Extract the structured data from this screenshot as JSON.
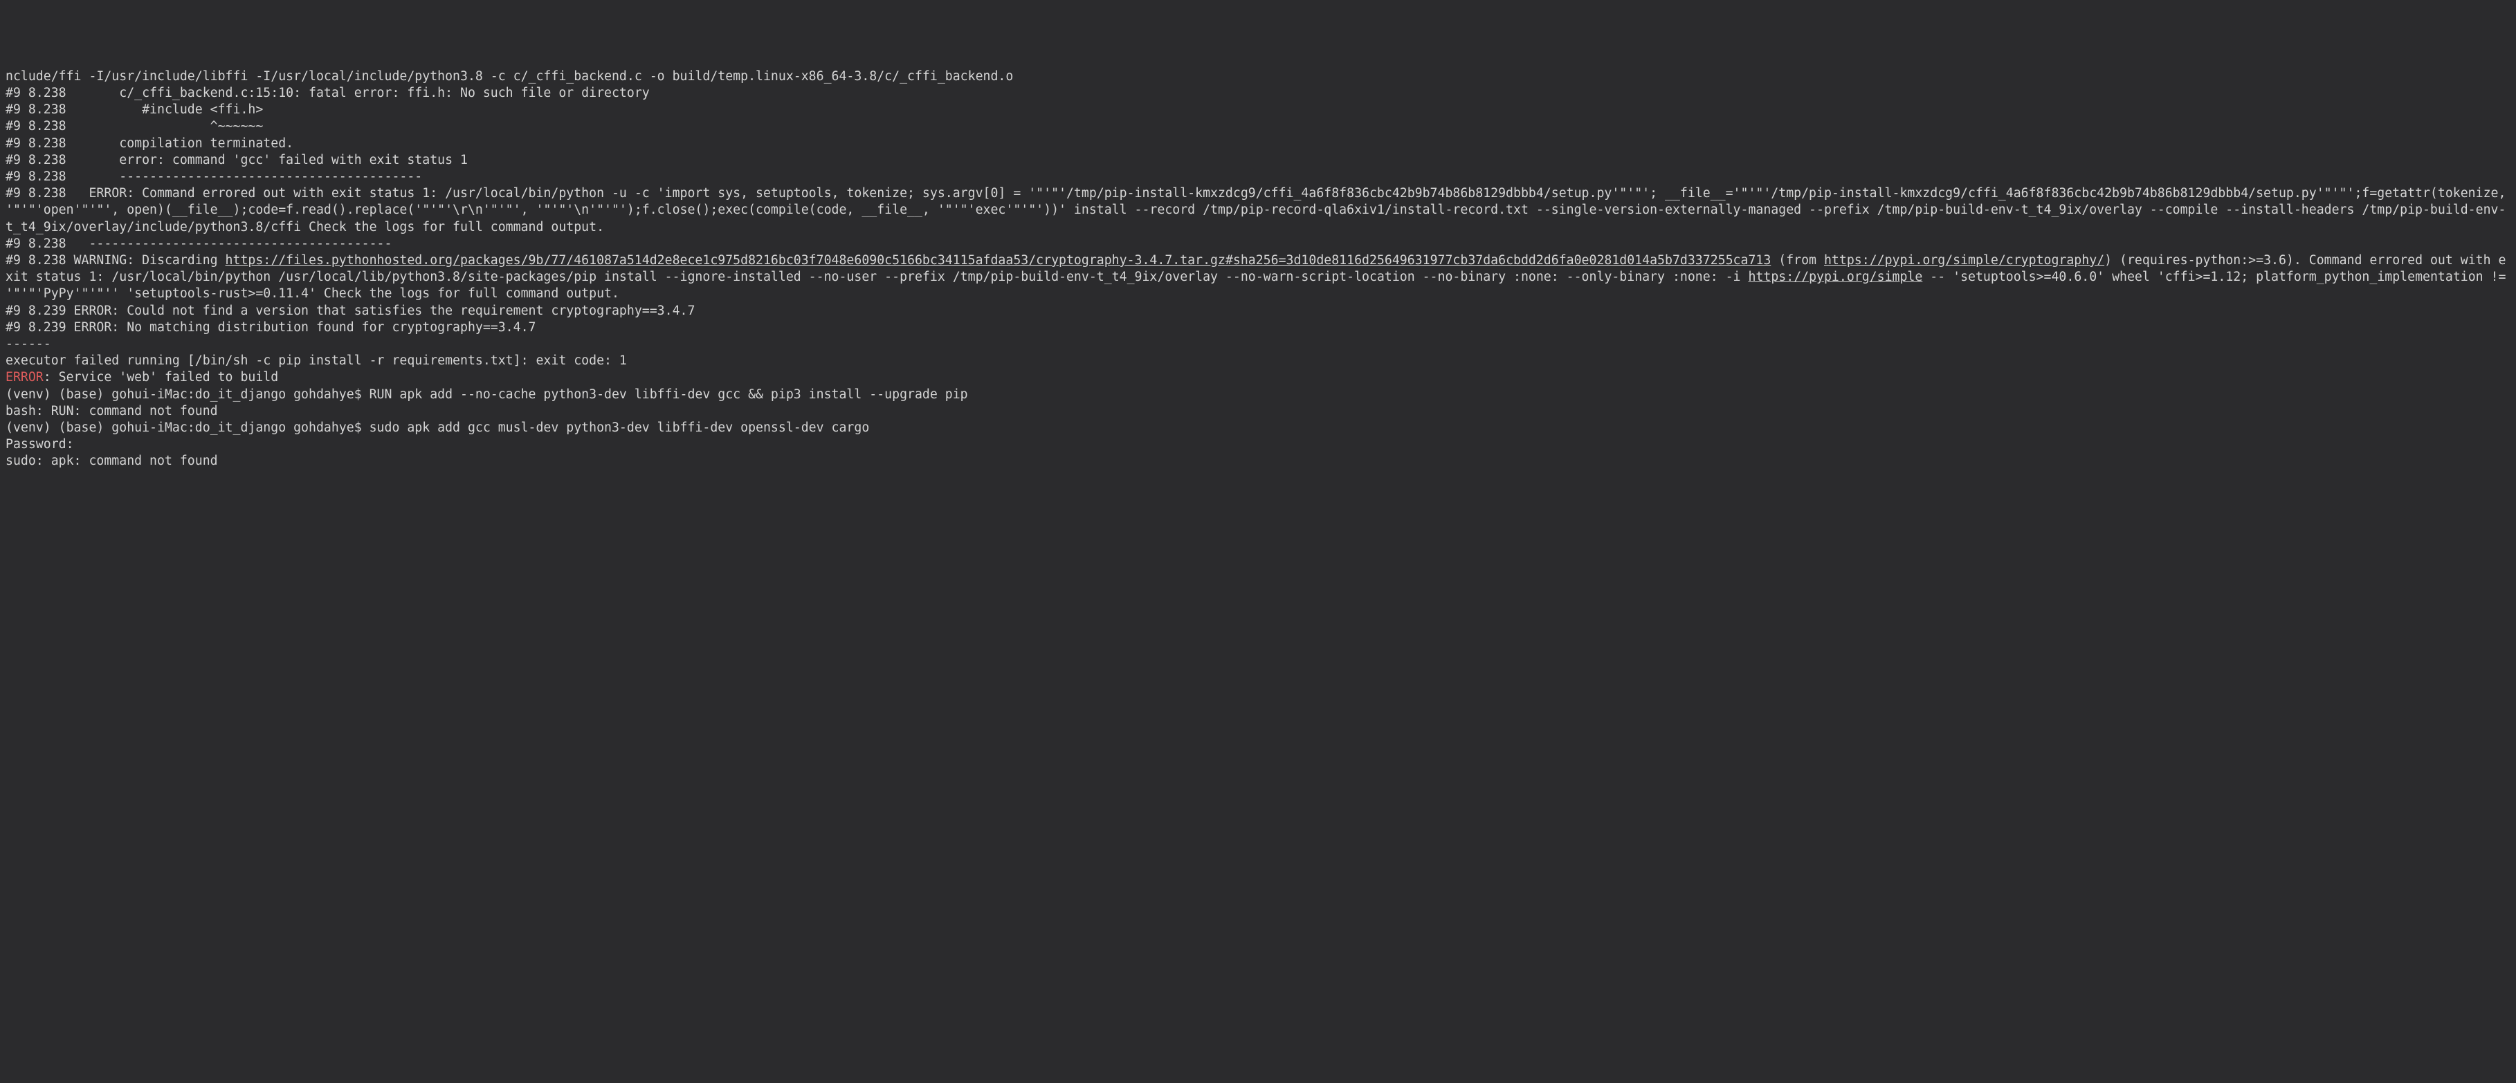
{
  "lines": {
    "l01": "nclude/ffi -I/usr/include/libffi -I/usr/local/include/python3.8 -c c/_cffi_backend.c -o build/temp.linux-x86_64-3.8/c/_cffi_backend.o",
    "l02": "#9 8.238       c/_cffi_backend.c:15:10: fatal error: ffi.h: No such file or directory",
    "l03": "#9 8.238          #include <ffi.h>",
    "l04": "#9 8.238                   ^~~~~~~",
    "l05": "#9 8.238       compilation terminated.",
    "l06": "#9 8.238       error: command 'gcc' failed with exit status 1",
    "l07": "#9 8.238       ----------------------------------------",
    "l08": "#9 8.238   ERROR: Command errored out with exit status 1: /usr/local/bin/python -u -c 'import sys, setuptools, tokenize; sys.argv[0] = '\"'\"'/tmp/pip-install-kmxzdcg9/cffi_4a6f8f836cbc42b9b74b86b8129dbbb4/setup.py'\"'\"'; __file__='\"'\"'/tmp/pip-install-kmxzdcg9/cffi_4a6f8f836cbc42b9b74b86b8129dbbb4/setup.py'\"'\"';f=getattr(tokenize, '\"'\"'open'\"'\"', open)(__file__);code=f.read().replace('\"'\"'\\r\\n'\"'\"', '\"'\"'\\n'\"'\"');f.close();exec(compile(code, __file__, '\"'\"'exec'\"'\"'))' install --record /tmp/pip-record-qla6xiv1/install-record.txt --single-version-externally-managed --prefix /tmp/pip-build-env-t_t4_9ix/overlay --compile --install-headers /tmp/pip-build-env-t_t4_9ix/overlay/include/python3.8/cffi Check the logs for full command output.",
    "l09": "#9 8.238   ----------------------------------------",
    "l10a": "#9 8.238 WARNING: Discarding ",
    "l10_link1": "https://files.pythonhosted.org/packages/9b/77/461087a514d2e8ece1c975d8216bc03f7048e6090c5166bc34115afdaa53/cryptography-3.4.7.tar.gz#sha256=3d10de8116d25649631977cb37da6cbdd2d6fa0e0281d014a5b7d337255ca713",
    "l10b": " (from ",
    "l10_link2": "https://pypi.org/simple/cryptography/",
    "l10c": ") (requires-python:>=3.6). Command errored out with exit status 1: /usr/local/bin/python /usr/local/lib/python3.8/site-packages/pip install --ignore-installed --no-user --prefix /tmp/pip-build-env-t_t4_9ix/overlay --no-warn-script-location --no-binary :none: --only-binary :none: -i ",
    "l10_link3": "https://pypi.org/simple",
    "l10d": " -- 'setuptools>=40.6.0' wheel 'cffi>=1.12; platform_python_implementation != '\"'\"'PyPy'\"'\"'' 'setuptools-rust>=0.11.4' Check the logs for full command output.",
    "l11": "#9 8.239 ERROR: Could not find a version that satisfies the requirement cryptography==3.4.7",
    "l12": "#9 8.239 ERROR: No matching distribution found for cryptography==3.4.7",
    "l13": "------",
    "l14": "executor failed running [/bin/sh -c pip install -r requirements.txt]: exit code: 1",
    "l15_err": "ERROR",
    "l15_rest": ": Service 'web' failed to build",
    "l16": "(venv) (base) gohui-iMac:do_it_django gohdahye$ RUN apk add --no-cache python3-dev libffi-dev gcc && pip3 install --upgrade pip",
    "l17": "bash: RUN: command not found",
    "l18": "(venv) (base) gohui-iMac:do_it_django gohdahye$ sudo apk add gcc musl-dev python3-dev libffi-dev openssl-dev cargo",
    "l19": "Password:",
    "l20": "sudo: apk: command not found"
  }
}
